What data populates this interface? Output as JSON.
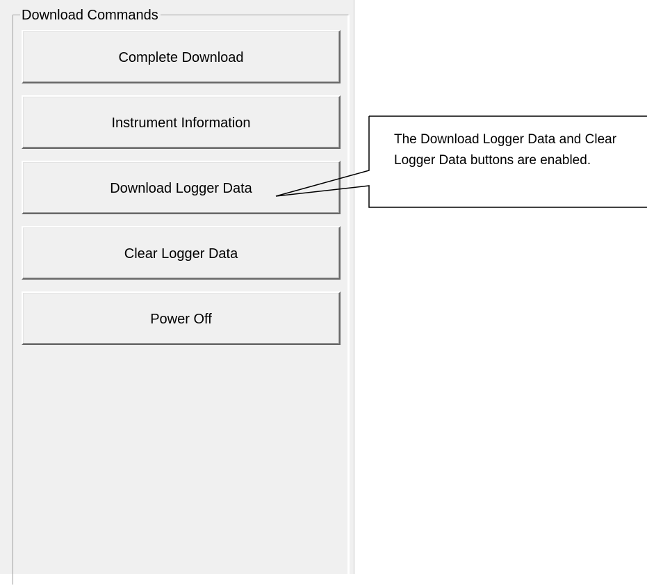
{
  "group": {
    "title": "Download Commands"
  },
  "buttons": [
    {
      "label": "Complete Download"
    },
    {
      "label": "Instrument Information"
    },
    {
      "label": "Download Logger Data"
    },
    {
      "label": "Clear Logger Data"
    },
    {
      "label": "Power Off"
    }
  ],
  "callout": {
    "text": "The Download Logger Data and Clear Logger Data buttons are enabled."
  }
}
